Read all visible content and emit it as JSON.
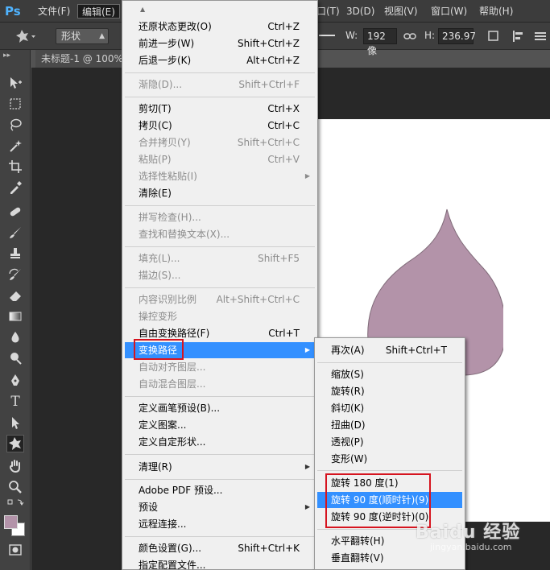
{
  "menubar": {
    "logo": "Ps",
    "items": [
      {
        "label": "文件(F)"
      },
      {
        "label": "编辑(E)"
      },
      {
        "label": "口(T)"
      },
      {
        "label": "3D(D)"
      },
      {
        "label": "视图(V)"
      },
      {
        "label": "窗口(W)"
      },
      {
        "label": "帮助(H)"
      }
    ]
  },
  "options_bar": {
    "mode_select": "形状",
    "w_label": "W:",
    "w_value": "192 像",
    "h_label": "H:",
    "h_value": "236.97"
  },
  "document": {
    "tab_title": "未标题-1 @ 100%",
    "shape_fill": "#b393a9",
    "foreground_color": "#b393a9",
    "background_color": "#ffffff"
  },
  "edit_menu": {
    "items": [
      {
        "label": "还原状态更改(O)",
        "shortcut": "Ctrl+Z"
      },
      {
        "label": "前进一步(W)",
        "shortcut": "Shift+Ctrl+Z"
      },
      {
        "label": "后退一步(K)",
        "shortcut": "Alt+Ctrl+Z"
      },
      {
        "label": "渐隐(D)...",
        "shortcut": "Shift+Ctrl+F"
      },
      {
        "label": "剪切(T)",
        "shortcut": "Ctrl+X"
      },
      {
        "label": "拷贝(C)",
        "shortcut": "Ctrl+C"
      },
      {
        "label": "合并拷贝(Y)",
        "shortcut": "Shift+Ctrl+C"
      },
      {
        "label": "粘贴(P)",
        "shortcut": "Ctrl+V"
      },
      {
        "label": "选择性粘贴(I)",
        "shortcut": ""
      },
      {
        "label": "清除(E)",
        "shortcut": ""
      },
      {
        "label": "拼写检查(H)...",
        "shortcut": ""
      },
      {
        "label": "查找和替换文本(X)...",
        "shortcut": ""
      },
      {
        "label": "填充(L)...",
        "shortcut": "Shift+F5"
      },
      {
        "label": "描边(S)...",
        "shortcut": ""
      },
      {
        "label": "内容识别比例",
        "shortcut": "Alt+Shift+Ctrl+C"
      },
      {
        "label": "操控变形",
        "shortcut": ""
      },
      {
        "label": "自由变换路径(F)",
        "shortcut": "Ctrl+T"
      },
      {
        "label": "变换路径",
        "shortcut": ""
      },
      {
        "label": "自动对齐图层...",
        "shortcut": ""
      },
      {
        "label": "自动混合图层...",
        "shortcut": ""
      },
      {
        "label": "定义画笔预设(B)...",
        "shortcut": ""
      },
      {
        "label": "定义图案...",
        "shortcut": ""
      },
      {
        "label": "定义自定形状...",
        "shortcut": ""
      },
      {
        "label": "清理(R)",
        "shortcut": ""
      },
      {
        "label": "Adobe PDF 预设...",
        "shortcut": ""
      },
      {
        "label": "预设",
        "shortcut": ""
      },
      {
        "label": "远程连接...",
        "shortcut": ""
      },
      {
        "label": "颜色设置(G)...",
        "shortcut": "Shift+Ctrl+K"
      },
      {
        "label": "指定配置文件...",
        "shortcut": ""
      }
    ]
  },
  "transform_submenu": {
    "items": [
      {
        "label": "再次(A)",
        "shortcut": "Shift+Ctrl+T"
      },
      {
        "label": "缩放(S)",
        "shortcut": ""
      },
      {
        "label": "旋转(R)",
        "shortcut": ""
      },
      {
        "label": "斜切(K)",
        "shortcut": ""
      },
      {
        "label": "扭曲(D)",
        "shortcut": ""
      },
      {
        "label": "透视(P)",
        "shortcut": ""
      },
      {
        "label": "变形(W)",
        "shortcut": ""
      },
      {
        "label": "旋转 180 度(1)",
        "shortcut": ""
      },
      {
        "label": "旋转 90 度(顺时针)(9)",
        "shortcut": ""
      },
      {
        "label": "旋转 90 度(逆时针)(0)",
        "shortcut": ""
      },
      {
        "label": "水平翻转(H)",
        "shortcut": ""
      },
      {
        "label": "垂直翻转(V)",
        "shortcut": ""
      }
    ]
  },
  "watermark": {
    "main": "Baidu 经验",
    "sub": "jingyan.baidu.com"
  }
}
